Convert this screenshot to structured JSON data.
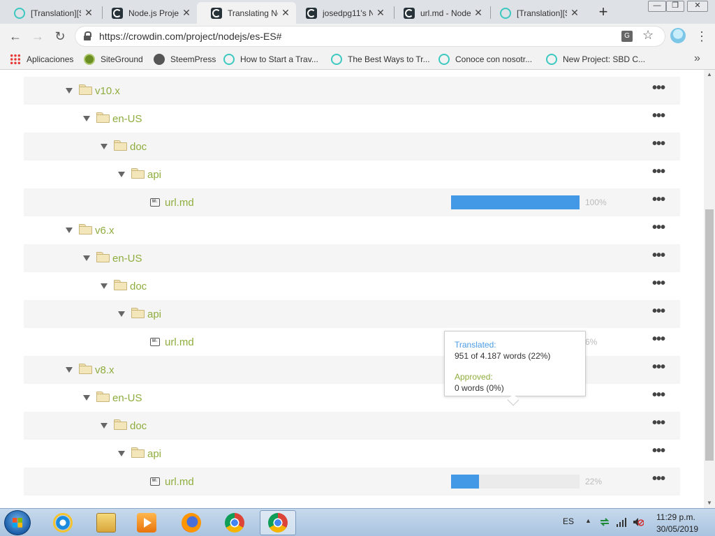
{
  "browser": {
    "tabs": [
      {
        "title": "[Translation][S",
        "icon": "steem-icon"
      },
      {
        "title": "Node.js Projec",
        "icon": "crowdin-icon"
      },
      {
        "title": "Translating No",
        "icon": "crowdin-icon",
        "active": true
      },
      {
        "title": "josedpg11's N",
        "icon": "crowdin-icon"
      },
      {
        "title": "url.md - Node",
        "icon": "crowdin-icon"
      },
      {
        "title": "[Translation][S",
        "icon": "steem-icon"
      }
    ],
    "url": "https://crowdin.com/project/nodejs/es-ES#",
    "bookmarks": [
      "Aplicaciones",
      "SiteGround",
      "SteemPress",
      "How to Start a Trav...",
      "The Best Ways to Tr...",
      "Conoce con nosotr...",
      "New Project: SBD C..."
    ]
  },
  "tree": [
    {
      "name": "v10.x",
      "type": "folder",
      "level": 0
    },
    {
      "name": "en-US",
      "type": "folder",
      "level": 1
    },
    {
      "name": "doc",
      "type": "folder",
      "level": 2
    },
    {
      "name": "api",
      "type": "folder",
      "level": 3
    },
    {
      "name": "url.md",
      "type": "file",
      "level": 4,
      "progress": 100,
      "progress_label": "100%"
    },
    {
      "name": "v6.x",
      "type": "folder",
      "level": 0
    },
    {
      "name": "en-US",
      "type": "folder",
      "level": 1
    },
    {
      "name": "doc",
      "type": "folder",
      "level": 2
    },
    {
      "name": "api",
      "type": "folder",
      "level": 3
    },
    {
      "name": "url.md",
      "type": "file",
      "level": 4,
      "progress": 6,
      "progress_label": "6%"
    },
    {
      "name": "v8.x",
      "type": "folder",
      "level": 0
    },
    {
      "name": "en-US",
      "type": "folder",
      "level": 1
    },
    {
      "name": "doc",
      "type": "folder",
      "level": 2
    },
    {
      "name": "api",
      "type": "folder",
      "level": 3
    },
    {
      "name": "url.md",
      "type": "file",
      "level": 4,
      "progress": 22,
      "progress_label": "22%"
    }
  ],
  "tooltip": {
    "translated_label": "Translated:",
    "translated_value": "951 of 4.187 words (22%)",
    "approved_label": "Approved:",
    "approved_value": "0 words (0%)"
  },
  "taskbar": {
    "lang": "ES",
    "time": "11:29 p.m.",
    "date": "30/05/2019"
  },
  "colors": {
    "folder_name": "#8fad3f",
    "progress_fill": "#4399e5",
    "translated_label": "#4a9be6",
    "approved_label": "#8fad3f"
  }
}
